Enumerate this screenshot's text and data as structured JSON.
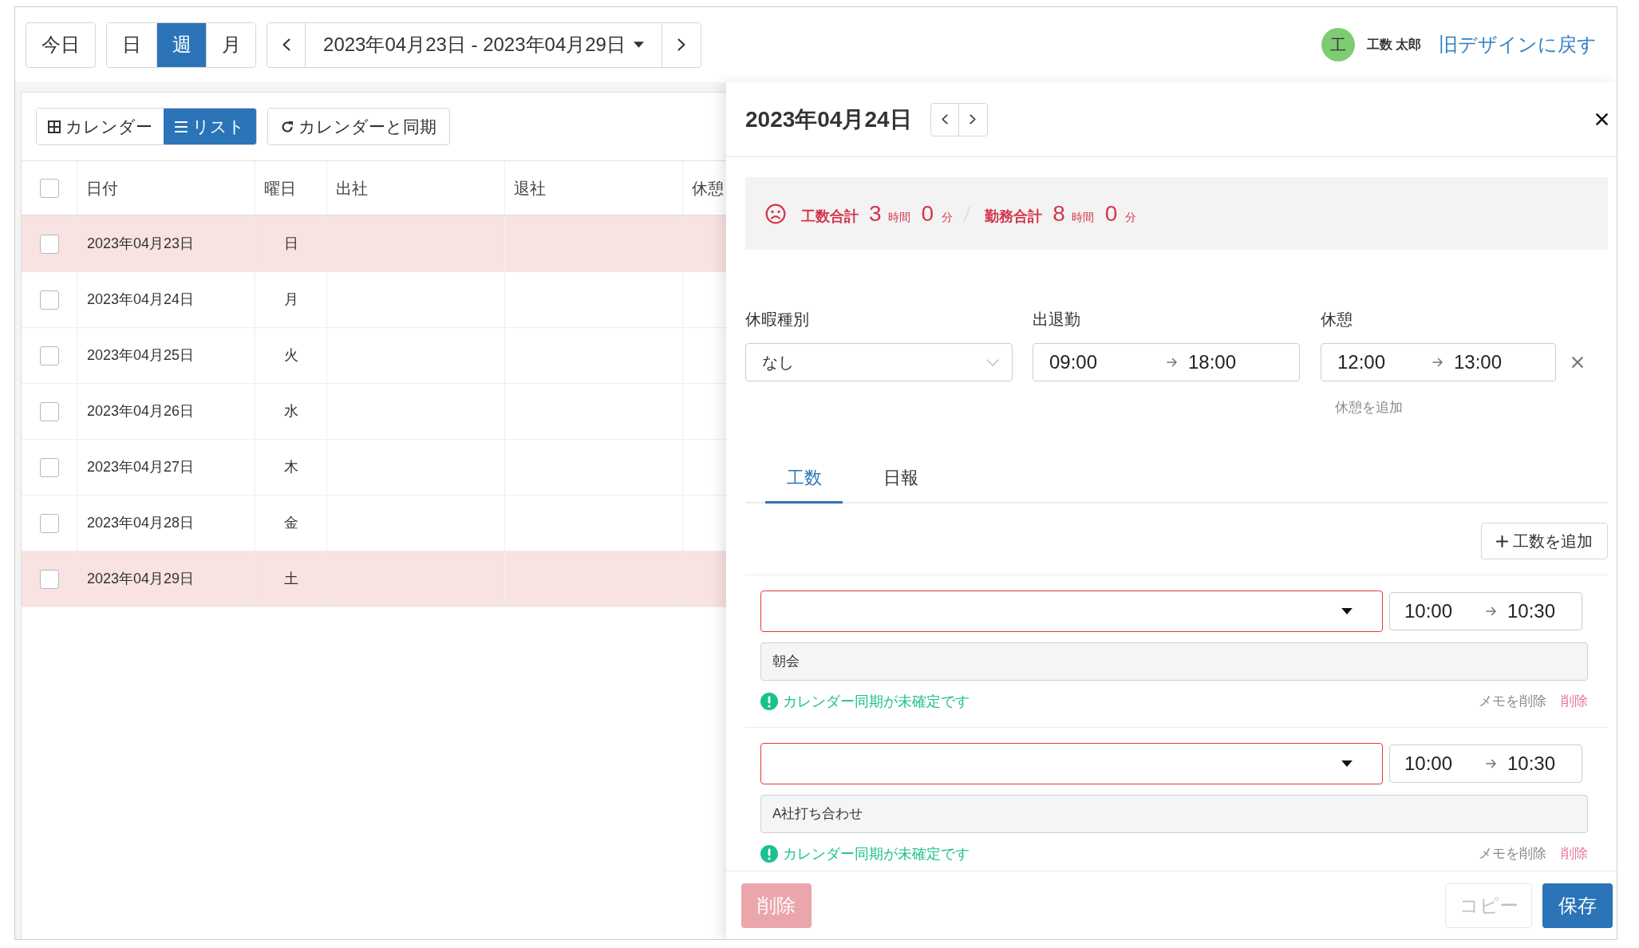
{
  "top_bar": {
    "today_button": "今日",
    "view_modes": [
      {
        "label": "日",
        "selected": false
      },
      {
        "label": "週",
        "selected": true
      },
      {
        "label": "月",
        "selected": false
      }
    ],
    "date_range": "2023年04月23日 - 2023年04月29日"
  },
  "user": {
    "avatar_initial": "工",
    "name": "工数 太郎",
    "old_design_link": "旧デザインに戻す"
  },
  "list_view": {
    "view_toggle": [
      {
        "kind": "calendar",
        "label": "カレンダー",
        "selected": false
      },
      {
        "kind": "list",
        "label": "リスト",
        "selected": true
      }
    ],
    "sync_button": "カレンダーと同期"
  },
  "table": {
    "header_checked": false,
    "columns": [
      "日付",
      "曜日",
      "出社",
      "退社",
      "休憩"
    ],
    "rows": [
      {
        "checked": false,
        "holiday": true,
        "date": "2023年04月23日",
        "weekday": "日"
      },
      {
        "checked": false,
        "holiday": false,
        "date": "2023年04月24日",
        "weekday": "月"
      },
      {
        "checked": false,
        "holiday": false,
        "date": "2023年04月25日",
        "weekday": "火"
      },
      {
        "checked": false,
        "holiday": false,
        "date": "2023年04月26日",
        "weekday": "水"
      },
      {
        "checked": false,
        "holiday": false,
        "date": "2023年04月27日",
        "weekday": "木"
      },
      {
        "checked": false,
        "holiday": false,
        "date": "2023年04月28日",
        "weekday": "金"
      },
      {
        "checked": false,
        "holiday": true,
        "date": "2023年04月29日",
        "weekday": "土"
      }
    ]
  },
  "detail_panel": {
    "date": "2023年04月24日",
    "summary": [
      {
        "label": "工数合計",
        "hours": "3",
        "hours_unit": "時間",
        "minutes": "0",
        "minutes_unit": "分"
      },
      {
        "label": "勤務合計",
        "hours": "8",
        "hours_unit": "時間",
        "minutes": "0",
        "minutes_unit": "分"
      }
    ],
    "leave_type": {
      "label": "休暇種別",
      "value": "なし"
    },
    "attendance": {
      "label": "出退勤",
      "start": "09:00",
      "end": "18:00"
    },
    "breaks": {
      "label": "休憩",
      "items": [
        {
          "start": "12:00",
          "end": "13:00"
        }
      ],
      "add_link": "休憩を追加"
    },
    "tabs": [
      {
        "label": "工数",
        "selected": true
      },
      {
        "label": "日報",
        "selected": false
      }
    ],
    "add_entry_button": "工数を追加",
    "entries": [
      {
        "invalid": true,
        "start": "10:00",
        "end": "10:30",
        "memo": "朝会",
        "sync_warning": "カレンダー同期が未確定です",
        "delete_memo_link": "メモを削除",
        "delete_link": "削除"
      },
      {
        "invalid": true,
        "start": "10:00",
        "end": "10:30",
        "memo": "A社打ち合わせ",
        "sync_warning": "カレンダー同期が未確定です",
        "delete_memo_link": "メモを削除",
        "delete_link": "削除"
      }
    ],
    "footer": {
      "delete_button": {
        "label": "削除",
        "disabled": true
      },
      "copy_button": {
        "label": "コピー",
        "disabled": true
      },
      "save_button": "保存"
    }
  }
}
